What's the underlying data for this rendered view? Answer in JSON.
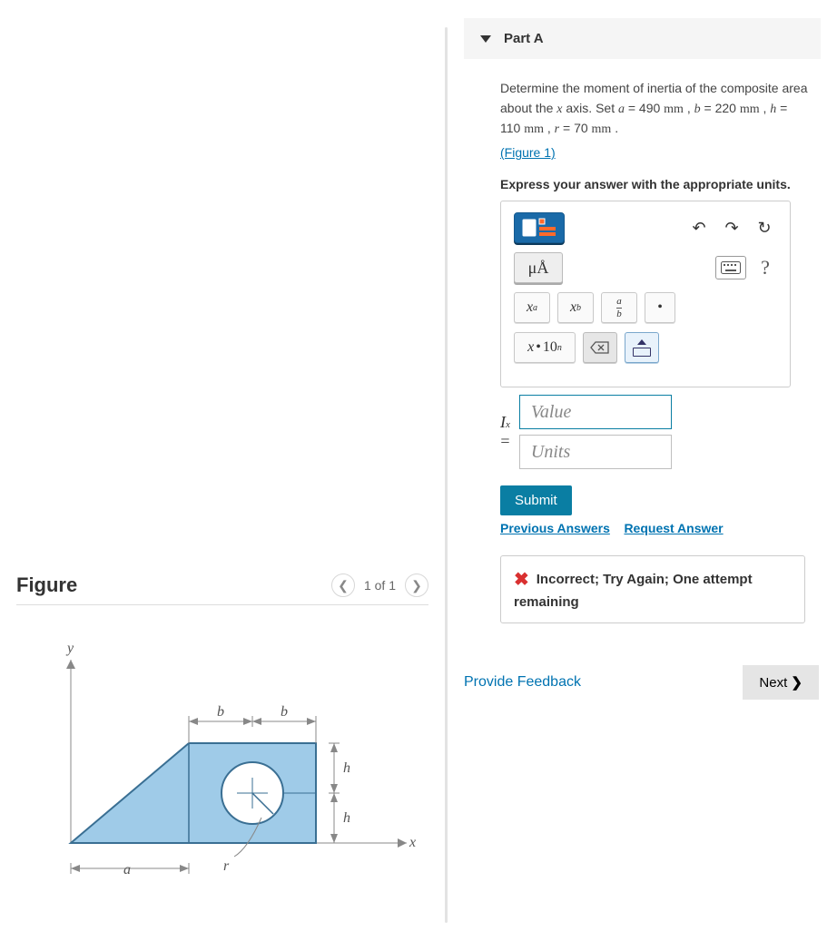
{
  "part": {
    "title": "Part A"
  },
  "problem": {
    "intro": "Determine the moment of inertia of the composite area about the ",
    "axis_var": "x",
    "intro2": " axis. Set ",
    "a_label": "a",
    "a_eq": " = 490 ",
    "a_unit": "mm",
    "sep": " , ",
    "b_label": "b",
    "b_eq": " = 220 ",
    "b_unit": "mm",
    "h_label": "h",
    "h_eq": " = 110 ",
    "h_unit": "mm",
    "r_label": "r",
    "r_eq": " = 70 ",
    "r_unit": "mm",
    "end": " .",
    "figure_link": "(Figure 1)",
    "express": "Express your answer with the appropriate units."
  },
  "toolbar": {
    "muA": "μÅ",
    "xa": "x",
    "xa_sup": "a",
    "xb": "x",
    "xb_sub": "b",
    "frac_a": "a",
    "frac_b": "b",
    "dot": "•",
    "sci": "x",
    "sci_dot": "•",
    "sci_ten": "10",
    "sci_n": "n"
  },
  "input": {
    "symbol": "I",
    "symbol_sub": "x",
    "equals": "=",
    "value_placeholder": "Value",
    "units_placeholder": "Units"
  },
  "actions": {
    "submit": "Submit",
    "previous": "Previous Answers",
    "request": "Request Answer"
  },
  "feedback": {
    "message": "Incorrect; Try Again; One attempt remaining"
  },
  "footer": {
    "provide": "Provide Feedback",
    "next": "Next",
    "chev": "❯"
  },
  "figure": {
    "heading": "Figure",
    "counter": "1 of 1",
    "labels": {
      "y": "y",
      "x": "x",
      "a": "a",
      "b": "b",
      "h": "h",
      "r": "r"
    }
  }
}
